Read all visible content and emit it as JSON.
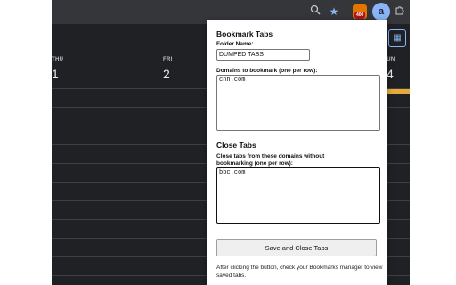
{
  "toolbar": {
    "zoom_icon": "zoom-icon",
    "star_icon": "star-icon",
    "ext_badge": "400",
    "ext_profile_letter": "a",
    "puzzle_icon": "puzzle-icon"
  },
  "calendar": {
    "days": [
      {
        "label": "THU",
        "num": "1"
      },
      {
        "label": "FRI",
        "num": "2"
      },
      {
        "label": "SUN",
        "num": "4"
      }
    ],
    "accent_color": "#e8a93b"
  },
  "popup": {
    "bookmark_title": "Bookmark Tabs",
    "folder_label": "Folder Name:",
    "folder_value": "DUMPED TABS",
    "domains_label": "Domains to bookmark (one per row):",
    "domains_value": "cnn.com",
    "close_title": "Close Tabs",
    "close_label": "Close tabs from these domains without bookmarking (one per row):",
    "close_value": "bbc.com",
    "button_label": "Save and Close Tabs",
    "note": "After clicking the button, check your Bookmarks manager to view saved tabs."
  }
}
